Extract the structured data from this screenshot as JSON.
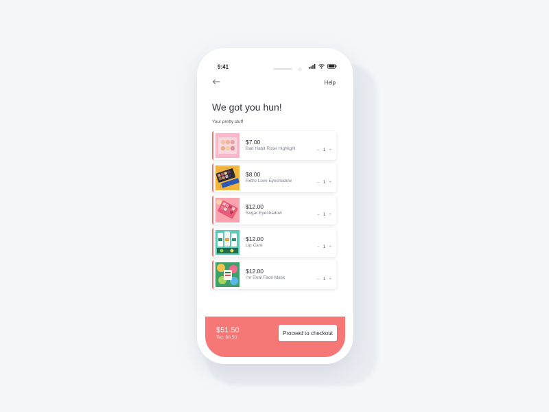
{
  "status": {
    "time": "9:41"
  },
  "nav": {
    "back_icon": "arrow-left-icon",
    "help_label": "Help"
  },
  "page": {
    "title": "We got you hun!",
    "subtitle": "Your pretty stuff"
  },
  "items": [
    {
      "price": "$7.00",
      "name": "Bad Habit Rose Highlight",
      "qty": "1",
      "minus": "–",
      "plus": "+",
      "image": "highlighter-palette-image"
    },
    {
      "price": "$8.00",
      "name": "Retro Love Eyeshadow",
      "qty": "1",
      "minus": "–",
      "plus": "+",
      "image": "eyeshadow-palette-image"
    },
    {
      "price": "$12.00",
      "name": "Sugar Eyeshadow",
      "qty": "1",
      "minus": "–",
      "plus": "+",
      "image": "pink-palette-image"
    },
    {
      "price": "$12.00",
      "name": "Lip Care",
      "qty": "1",
      "minus": "–",
      "plus": "+",
      "image": "lip-care-image"
    },
    {
      "price": "$12.00",
      "name": "I'm Real Face Mask",
      "qty": "1",
      "minus": "–",
      "plus": "+",
      "image": "face-mask-image"
    }
  ],
  "footer": {
    "total": "$51.50",
    "tax": "Tax: $0.50",
    "checkout_label": "Proceed to checkout"
  },
  "colors": {
    "accent": "#f67876",
    "background": "#f4f6f9",
    "text": "#2c2f3a"
  }
}
